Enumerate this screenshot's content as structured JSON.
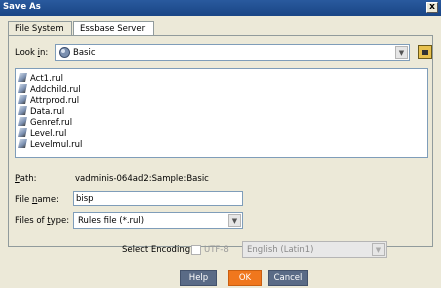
{
  "window": {
    "title": "Save As",
    "close_label": "x"
  },
  "tabs": [
    {
      "label": "File System",
      "active": false
    },
    {
      "label": "Essbase Server",
      "active": true
    }
  ],
  "look_in": {
    "label_pre": "Look ",
    "label_u": "i",
    "label_post": "n:",
    "value": "Basic"
  },
  "files": [
    "Act1.rul",
    "Addchild.rul",
    "Attrprod.rul",
    "Data.rul",
    "Genref.rul",
    "Level.rul",
    "Levelmul.rul"
  ],
  "path": {
    "label_u": "P",
    "label_post": "ath:",
    "value": "vadminis-064ad2:Sample:Basic"
  },
  "file_name": {
    "label_pre": "File ",
    "label_u": "n",
    "label_post": "ame:",
    "value": "bisp"
  },
  "file_type": {
    "label_pre": "Files of ",
    "label_u": "t",
    "label_post": "ype:",
    "value": "Rules file (*.rul)"
  },
  "encoding": {
    "label": "Select Encoding",
    "utf8_label": "UTF-8",
    "utf8_checked": false,
    "value": "English (Latin1)"
  },
  "buttons": {
    "help": "Help",
    "ok": "OK",
    "cancel": "Cancel"
  },
  "colors": {
    "titlebar": "#1a4585",
    "ok_button": "#f0771d",
    "button": "#5a6b86"
  }
}
